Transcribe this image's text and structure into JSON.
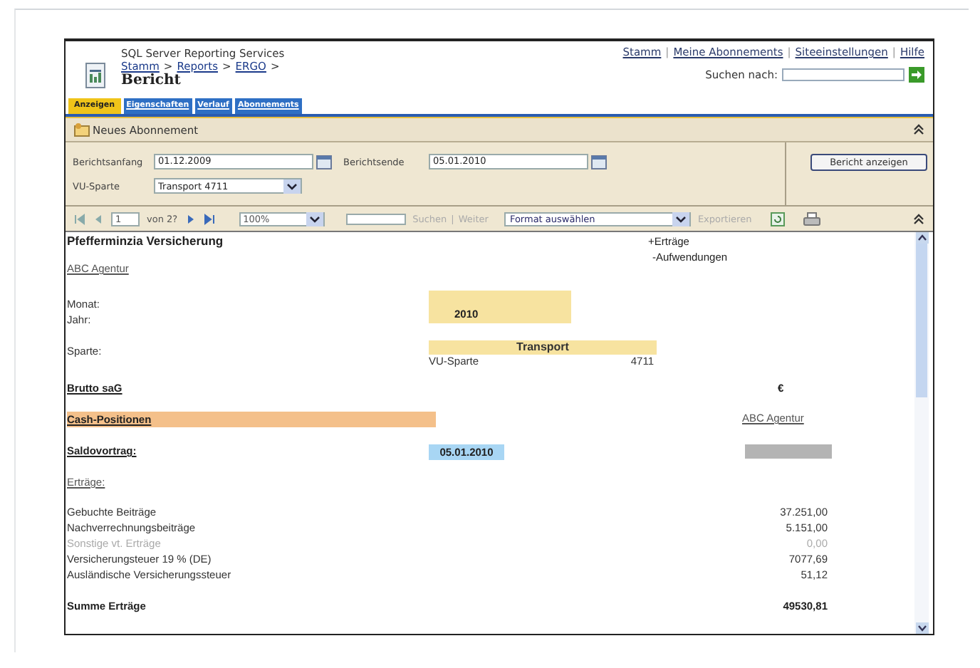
{
  "header": {
    "product": "SQL Server Reporting Services",
    "breadcrumb": [
      {
        "text": "Stamm",
        "kind": "link"
      },
      {
        "text": ">",
        "kind": "sep"
      },
      {
        "text": "Reports",
        "kind": "link"
      },
      {
        "text": ">",
        "kind": "sep"
      },
      {
        "text": "ERGO",
        "kind": "link"
      },
      {
        "text": ">",
        "kind": "sep"
      }
    ],
    "title": "Bericht",
    "links": [
      {
        "text": "Stamm",
        "kind": "link"
      },
      {
        "text": "|",
        "kind": "sep"
      },
      {
        "text": "Meine Abonnements",
        "kind": "link"
      },
      {
        "text": "|",
        "kind": "sep"
      },
      {
        "text": "Siteeinstellungen",
        "kind": "link"
      },
      {
        "text": "|",
        "kind": "sep"
      },
      {
        "text": "Hilfe",
        "kind": "link"
      }
    ],
    "search_label": "Suchen nach:"
  },
  "tabs": [
    {
      "label": "Anzeigen",
      "selected": true
    },
    {
      "label": "Eigenschaften",
      "selected": false
    },
    {
      "label": "Verlauf",
      "selected": false
    },
    {
      "label": "Abonnements",
      "selected": false
    }
  ],
  "toolbar": {
    "new_subscription": "Neues Abonnement"
  },
  "parameters": [
    {
      "label": "Berichtsanfang",
      "value": "01.12.2009",
      "kind": "date"
    },
    {
      "label": "Berichtsende",
      "value": "05.01.2010",
      "kind": "date"
    },
    {
      "label": "VU-Sparte",
      "value": "Transport 4711",
      "kind": "select"
    }
  ],
  "run_button": "Bericht anzeigen",
  "navigation": {
    "page": "1",
    "page_count": "von 2?",
    "zoom": "100%",
    "find": "Suchen",
    "find_sep": "|",
    "next": "Weiter",
    "format": "Format auswählen",
    "export": "Exportieren"
  },
  "report": {
    "title": "Pfefferminzia Versicherung",
    "legend": [
      "+Erträge",
      "-Aufwendungen"
    ],
    "agency": "ABC Agentur",
    "month_label": "Monat:",
    "year_label": "Jahr:",
    "year": "2010",
    "branch_label": "Sparte:",
    "branch": "Transport",
    "branch_code_label": "VU-Sparte",
    "branch_code": "4711",
    "gross_label": "Brutto saG",
    "currency": "€",
    "cash_label": "Cash-Positionen",
    "cash_agency": "ABC Agentur",
    "balance_label": "Saldovortrag:",
    "balance_date": "05.01.2010",
    "income_label": "Erträge:",
    "income": [
      {
        "label": "Gebuchte Beiträge",
        "value": "37.251,00",
        "disabled": false
      },
      {
        "label": "Nachverrechnungsbeiträge",
        "value": "5.151,00",
        "disabled": false
      },
      {
        "label": "Sonstige vt. Erträge",
        "value": "0,00",
        "disabled": true
      },
      {
        "label": "Versicherungsteuer 19 % (DE)",
        "value": "7077,69",
        "disabled": false
      },
      {
        "label": "Ausländische Versicherungssteuer",
        "value": "51,12",
        "disabled": false
      }
    ],
    "total_label": "Summe Erträge",
    "total": "49530,81"
  }
}
